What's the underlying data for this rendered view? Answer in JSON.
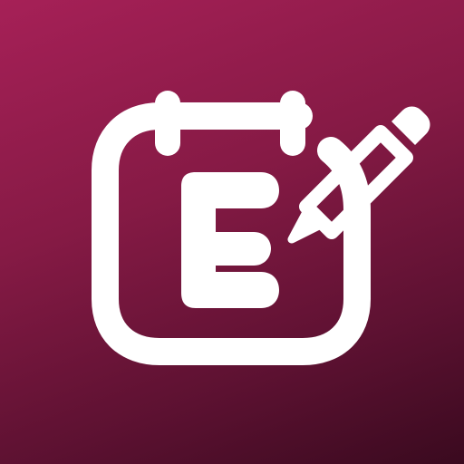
{
  "icon": {
    "glyph_letter": "E",
    "glyph_name": "notepad-edit-icon",
    "colors": {
      "background_top": "#a62057",
      "background_bottom": "#3a0a1f",
      "foreground": "#ffffff"
    }
  }
}
